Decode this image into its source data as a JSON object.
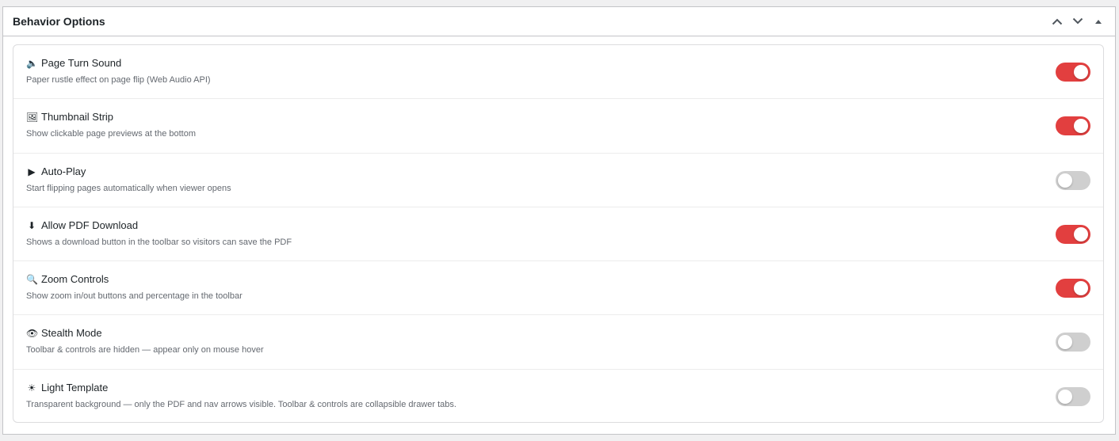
{
  "panel": {
    "title": "Behavior Options"
  },
  "colors": {
    "toggle_on": "#e23f3f",
    "toggle_off": "#cfcfcf"
  },
  "settings": [
    {
      "icon": "speaker-icon",
      "glyph": "🔈",
      "title": "Page Turn Sound",
      "description": "Paper rustle effect on page flip (Web Audio API)",
      "enabled": true
    },
    {
      "icon": "picture-icon",
      "glyph": "🖼",
      "title": "Thumbnail Strip",
      "description": "Show clickable page previews at the bottom",
      "enabled": true
    },
    {
      "icon": "play-icon",
      "glyph": "▶",
      "title": "Auto-Play",
      "description": "Start flipping pages automatically when viewer opens",
      "enabled": false
    },
    {
      "icon": "download-arrow-icon",
      "glyph": "⬇",
      "title": "Allow PDF Download",
      "description": "Shows a download button in the toolbar so visitors can save the PDF",
      "enabled": true
    },
    {
      "icon": "magnifier-icon",
      "glyph": "🔍",
      "title": "Zoom Controls",
      "description": "Show zoom in/out buttons and percentage in the toolbar",
      "enabled": true
    },
    {
      "icon": "eye-icon",
      "glyph": "👁",
      "title": "Stealth Mode",
      "description": "Toolbar & controls are hidden — appear only on mouse hover",
      "enabled": false
    },
    {
      "icon": "sun-icon",
      "glyph": "☀",
      "title": "Light Template",
      "description": "Transparent background — only the PDF and nav arrows visible. Toolbar & controls are collapsible drawer tabs.",
      "enabled": false
    }
  ]
}
